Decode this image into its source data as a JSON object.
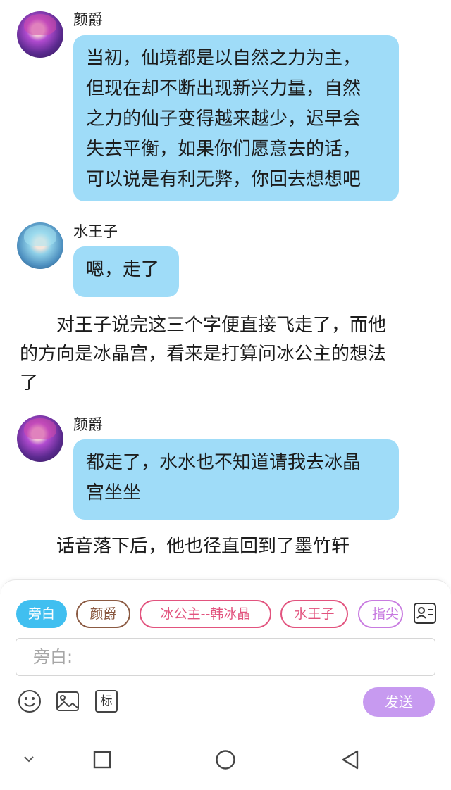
{
  "messages": [
    {
      "speaker": "颜爵",
      "lines": [
        "当初，仙境都是以自然之力为主，",
        "但现在却不断出现新兴力量，自然",
        "之力的仙子变得越来越少，迟早会",
        "失去平衡，如果你们愿意去的话，",
        "可以说是有利无弊，你回去想想吧"
      ]
    },
    {
      "speaker": "水王子",
      "lines": [
        "嗯，走了"
      ]
    },
    {
      "speaker": "颜爵",
      "lines": [
        "都走了，水水也不知道请我去冰晶",
        "宫坐坐"
      ]
    }
  ],
  "narrations": [
    {
      "lines": [
        "　　对王子说完这三个字便直接飞走了，而他",
        "的方向是冰晶宫，看来是打算问冰公主的想法",
        "了"
      ]
    },
    {
      "lines": [
        "　　话音落下后，他也径直回到了墨竹轩"
      ]
    }
  ],
  "composer": {
    "roles": [
      "旁白",
      "颜爵",
      "冰公主--韩冰晶",
      "水王子",
      "指尖"
    ],
    "input_placeholder": "旁白:",
    "tools": {
      "emoji_icon": "emoji-icon",
      "image_icon": "image-icon",
      "mark_label": "标"
    },
    "send_label": "发送"
  },
  "navigation": {
    "icons": [
      "chevron-down-icon",
      "square-recents-icon",
      "circle-home-icon",
      "triangle-back-icon"
    ]
  },
  "colors": {
    "bubble": "#9fdcf8",
    "active_chip": "#40bff0",
    "send": "#c79af0",
    "pink_chip": "#e2537e",
    "brown_chip": "#8b5a42"
  }
}
